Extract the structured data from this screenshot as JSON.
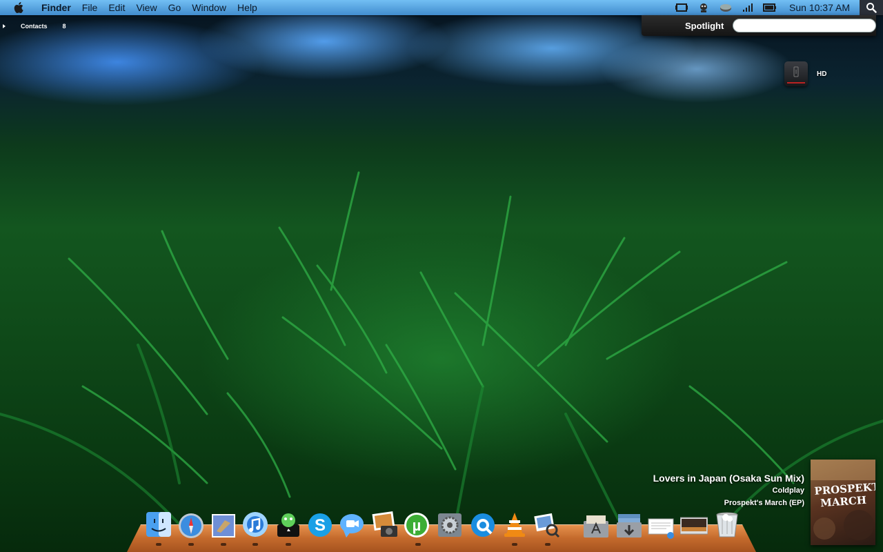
{
  "menubar": {
    "app_name": "Finder",
    "menus": [
      "File",
      "Edit",
      "View",
      "Go",
      "Window",
      "Help"
    ],
    "status_icons": [
      "display-icon",
      "robot-icon",
      "mixer-icon",
      "signal-bars-icon",
      "battery-icon"
    ],
    "clock": "Sun 10:37 AM"
  },
  "spotlight": {
    "label": "Spotlight",
    "value": ""
  },
  "contacts_widget": {
    "label": "Contacts",
    "count": "8"
  },
  "desktop": {
    "hd_label": "HD"
  },
  "now_playing": {
    "track": "Lovers in Japan (Osaka Sun Mix)",
    "artist": "Coldplay",
    "album": "Prospekt's March (EP)",
    "art_text": "PROSPEKT'S MARCH"
  },
  "dock": {
    "items": [
      {
        "name": "finder-icon",
        "running": true
      },
      {
        "name": "safari-icon",
        "running": true
      },
      {
        "name": "mail-icon",
        "running": true
      },
      {
        "name": "itunes-icon",
        "running": true
      },
      {
        "name": "adium-icon",
        "running": true
      },
      {
        "name": "skype-icon",
        "running": false
      },
      {
        "name": "ichat-icon",
        "running": false
      },
      {
        "name": "iphoto-icon",
        "running": true
      },
      {
        "name": "utorrent-icon",
        "running": false
      },
      {
        "name": "system-preferences-icon",
        "running": false
      },
      {
        "name": "quicktime-icon",
        "running": false
      },
      {
        "name": "vlc-icon",
        "running": true
      },
      {
        "name": "preview-icon",
        "running": true
      },
      {
        "name": "applications-folder-icon",
        "running": false
      },
      {
        "name": "downloads-folder-icon",
        "running": false
      },
      {
        "name": "documents-stack-icon",
        "running": false
      },
      {
        "name": "screenshots-stack-icon",
        "running": false
      },
      {
        "name": "trash-icon",
        "running": false
      }
    ]
  }
}
